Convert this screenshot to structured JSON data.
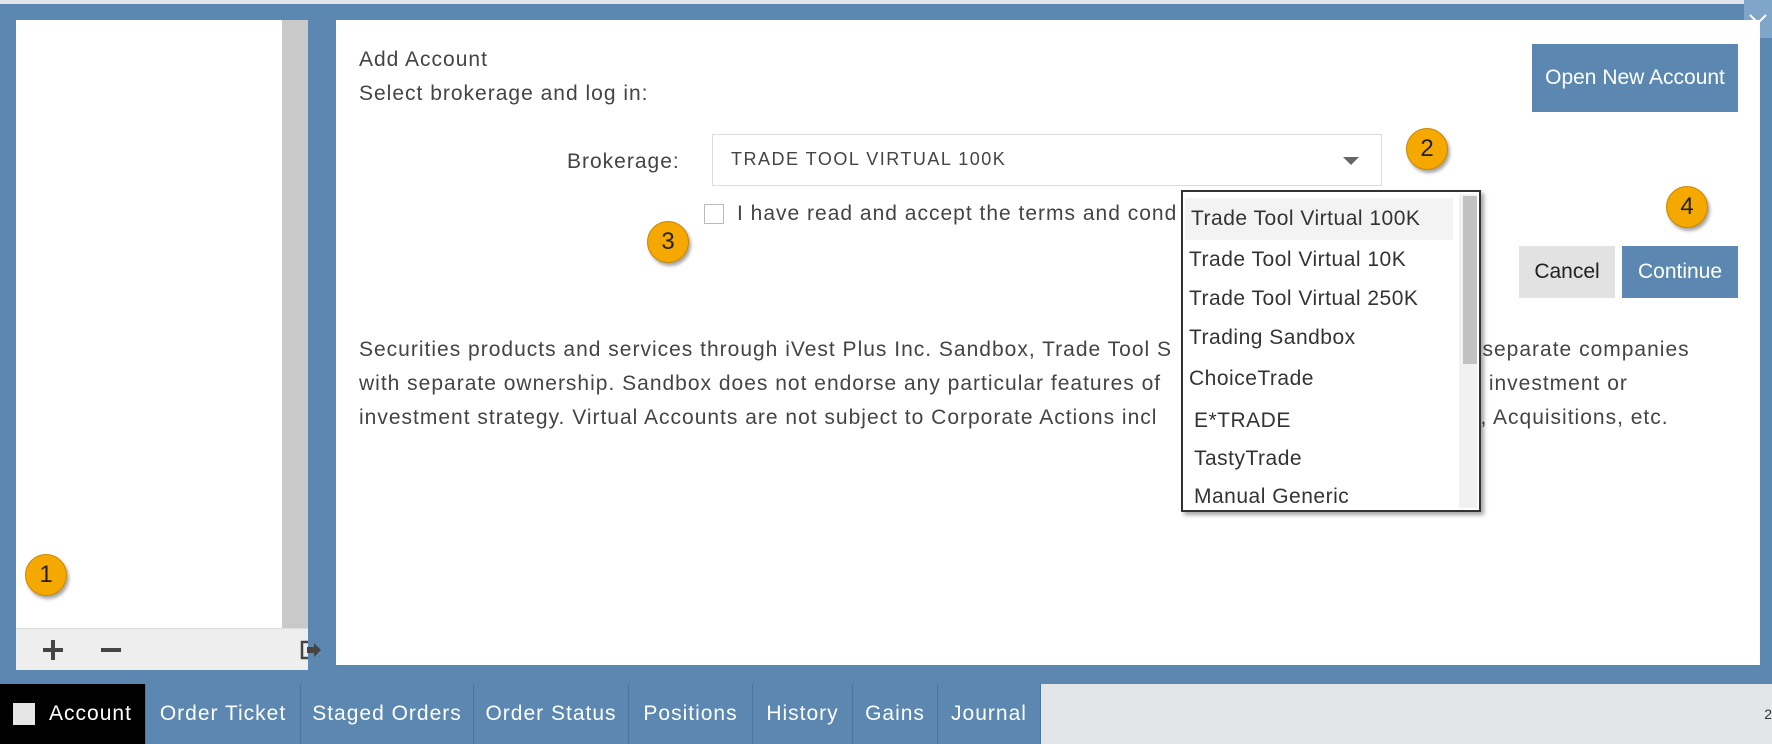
{
  "dialog": {
    "title": "Add Account",
    "subtitle": "Select brokerage and log in:",
    "open_new_account_label": "Open New Account",
    "brokerage_label": "Brokerage:",
    "brokerage_value": "TRADE TOOL VIRTUAL 100K",
    "terms_label": "I have read and accept the terms and cond",
    "cancel_label": "Cancel",
    "continue_label": "Continue",
    "disclaimer_lines": [
      "Securities products and services through iVest Plus Inc. Sandbox, Trade Tool S",
      "re separate companies",
      "with separate ownership. Sandbox does not endorse any particular features of",
      "r investment or",
      "investment strategy. Virtual Accounts are not subject to Corporate Actions incl",
      "s, Acquisitions, etc."
    ]
  },
  "dropdown": {
    "options": [
      "Trade Tool Virtual 100K",
      "Trade Tool Virtual 10K",
      "Trade Tool Virtual 250K",
      "Trading Sandbox",
      "ChoiceTrade",
      "E*TRADE",
      "TastyTrade",
      "Manual Generic"
    ],
    "selected": "Trade Tool Virtual 100K"
  },
  "callouts": [
    "1",
    "2",
    "3",
    "4"
  ],
  "left_toolbar": {
    "icons": [
      "plus-icon",
      "minus-icon",
      "logout-icon"
    ]
  },
  "tabs": [
    {
      "label": "Account",
      "active": true
    },
    {
      "label": "Order Ticket"
    },
    {
      "label": "Staged Orders"
    },
    {
      "label": "Order Status"
    },
    {
      "label": "Positions"
    },
    {
      "label": "History"
    },
    {
      "label": "Gains"
    },
    {
      "label": "Journal"
    }
  ],
  "edge_number": "2",
  "colors": {
    "accent": "#5b87b0",
    "callout": "#f5a800",
    "active_tab": "#000000"
  }
}
